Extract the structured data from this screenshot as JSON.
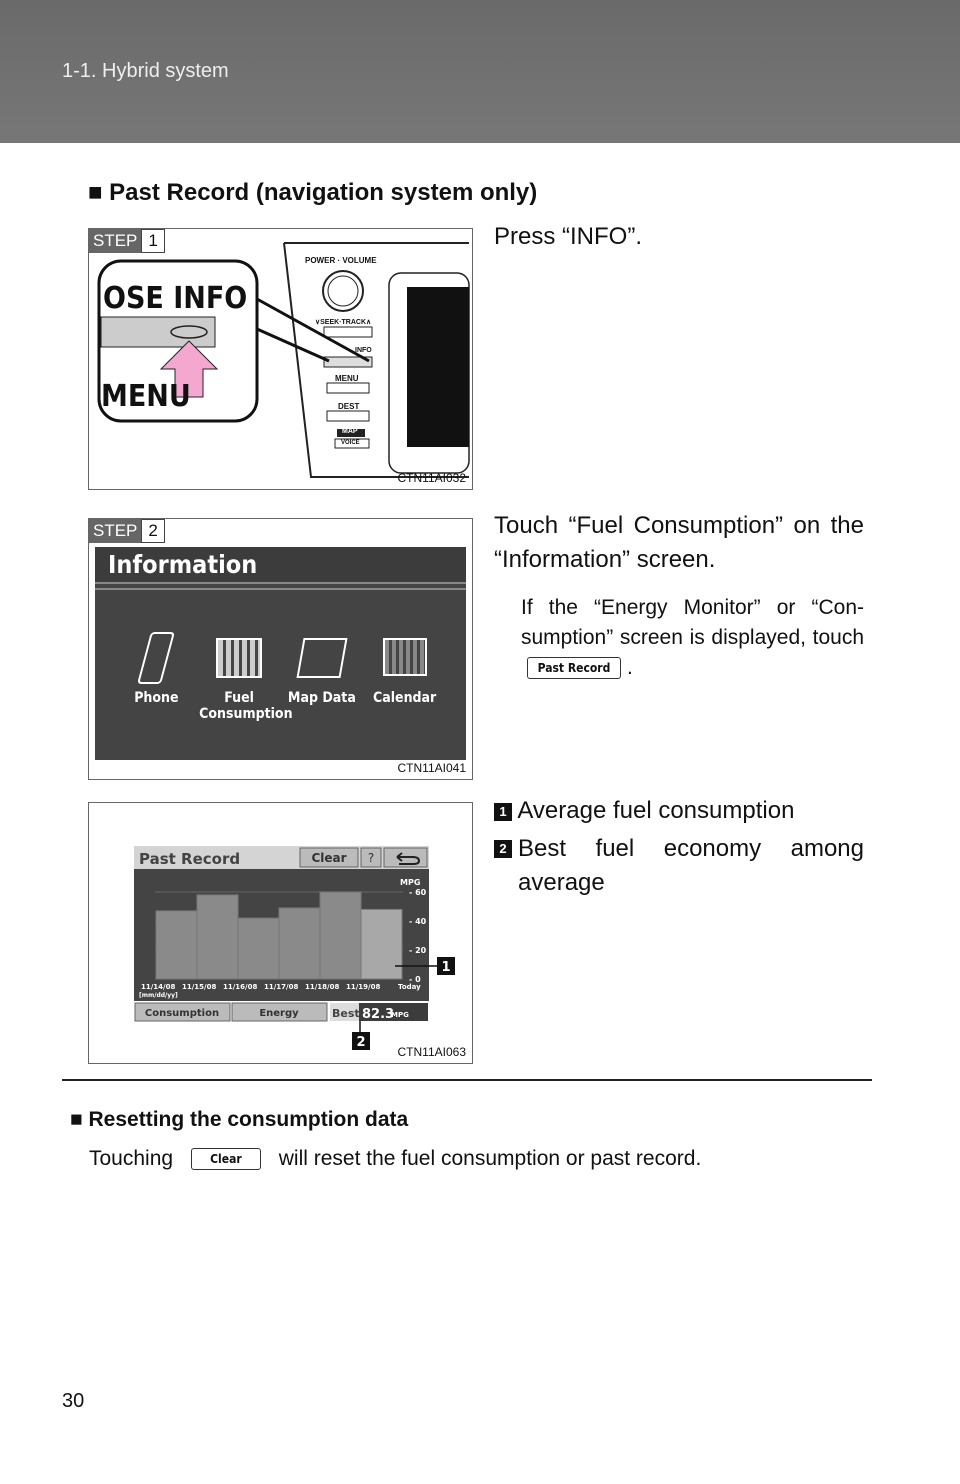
{
  "header": {
    "section": "1-1. Hybrid system"
  },
  "heading": "■ Past Record (navigation system only)",
  "step1": {
    "step_label": "STEP",
    "step_num": "1",
    "instruction": "Press “INFO”.",
    "figure_code": "CTN11AI032",
    "zoom_labels": {
      "top": "OSE  INFO",
      "bottom": "MENU"
    },
    "panel": {
      "power": "POWER · VOLUME",
      "seek": "∨SEEK·TRACK∧",
      "info": "INFO",
      "menu": "MENU",
      "dest": "DEST",
      "map": "MAP",
      "voice": "VOICE"
    },
    "arrow_color": "#f4a8d0"
  },
  "step2": {
    "step_label": "STEP",
    "step_num": "2",
    "instruction": "Touch “Fuel Consumption” on the “Information” screen.",
    "note_before": "If the “Energy Monitor” or “Con-sumption” screen is displayed, touch",
    "note_button": "Past Record",
    "note_after": ".",
    "figure_code": "CTN11AI041",
    "screen": {
      "title": "Information",
      "items": [
        {
          "label": "Phone",
          "icon": "phone-icon"
        },
        {
          "label": "Fuel Consumption",
          "icon": "bar-chart-icon"
        },
        {
          "label": "Map Data",
          "icon": "map-icon"
        },
        {
          "label": "Calendar",
          "icon": "calendar-icon"
        }
      ]
    }
  },
  "step3": {
    "figure_code": "CTN11AI063",
    "legend": [
      {
        "num": "1",
        "text": "Average fuel consumption"
      },
      {
        "num": "2",
        "text": "Best fuel economy among average"
      }
    ],
    "screen": {
      "title": "Past Record",
      "clear": "Clear",
      "help": "?",
      "back_icon": "return-arrow-icon",
      "consumption_tab": "Consumption",
      "energy_tab": "Energy",
      "best_label": "Best",
      "best_value": "82.3",
      "best_unit": "MPG"
    }
  },
  "chart_data": {
    "type": "bar",
    "categories": [
      "11/14/08",
      "11/15/08",
      "11/16/08",
      "11/17/08",
      "11/18/08",
      "11/19/08",
      "Today"
    ],
    "values": [
      47,
      58,
      42,
      49,
      60,
      48
    ],
    "ylabel": "MPG",
    "yticks": [
      "0",
      "20",
      "40",
      "60"
    ],
    "ylim": [
      0,
      60
    ],
    "date_format": "[mm/dd/yy]",
    "grid": true
  },
  "reset": {
    "heading": "■ Resetting the consumption data",
    "before": "Touching",
    "button": "Clear",
    "after": "will reset the fuel consumption or past record."
  },
  "page_number": "30"
}
